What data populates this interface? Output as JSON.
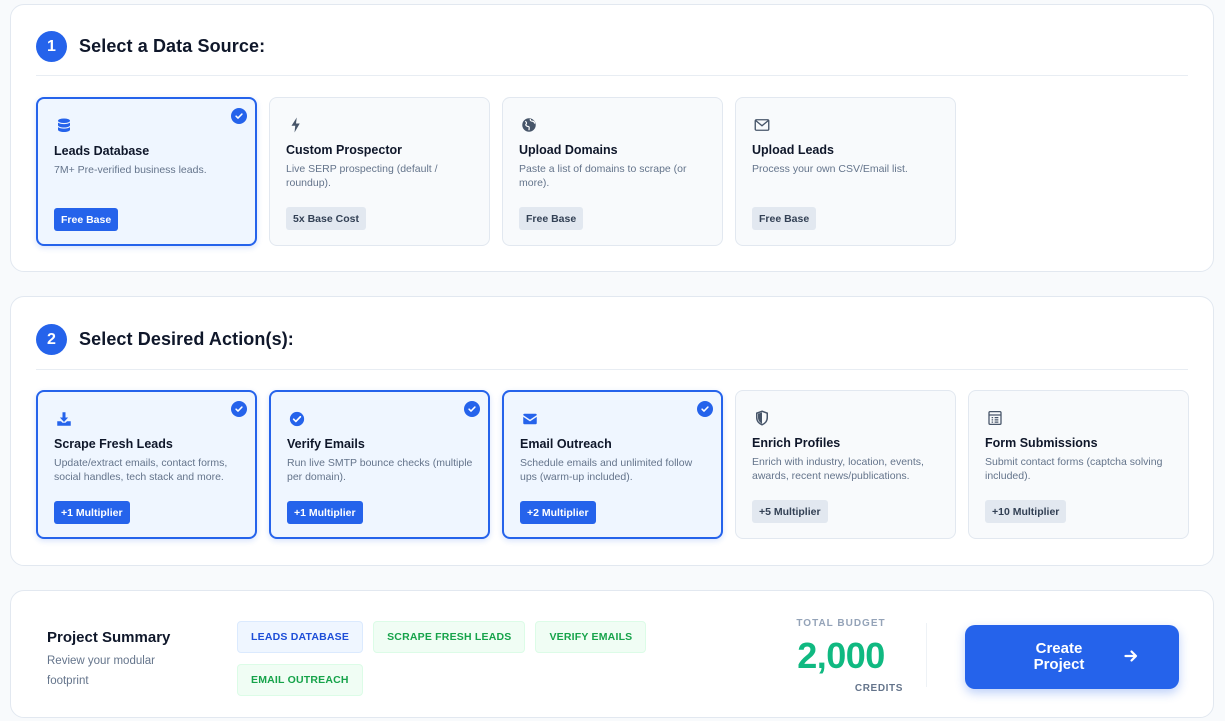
{
  "source_section": {
    "step": "1",
    "title": "Select a Data Source:",
    "cards": [
      {
        "icon": "database-icon",
        "title": "Leads Database",
        "desc": "7M+ Pre-verified business leads.",
        "badge": "Free Base",
        "selected": true
      },
      {
        "icon": "bolt-icon",
        "title": "Custom Prospector",
        "desc": "Live SERP prospecting (default / roundup).",
        "badge": "5x Base Cost",
        "selected": false
      },
      {
        "icon": "globe-icon",
        "title": "Upload Domains",
        "desc": "Paste a list of domains to scrape (or more).",
        "badge": "Free Base",
        "selected": false
      },
      {
        "icon": "envelope-outline-icon",
        "title": "Upload Leads",
        "desc": "Process your own CSV/Email list.",
        "badge": "Free Base",
        "selected": false
      }
    ]
  },
  "action_section": {
    "step": "2",
    "title": "Select Desired Action(s):",
    "cards": [
      {
        "icon": "download-icon",
        "title": "Scrape Fresh Leads",
        "desc": "Update/extract emails, contact forms, social handles, tech stack and more.",
        "badge": "+1 Multiplier",
        "selected": true
      },
      {
        "icon": "check-circle-icon",
        "title": "Verify Emails",
        "desc": "Run live SMTP bounce checks (multiple per domain).",
        "badge": "+1 Multiplier",
        "selected": true
      },
      {
        "icon": "envelope-filled-icon",
        "title": "Email Outreach",
        "desc": "Schedule emails and unlimited follow ups (warm-up included).",
        "badge": "+2 Multiplier",
        "selected": true
      },
      {
        "icon": "shield-icon",
        "title": "Enrich Profiles",
        "desc": "Enrich with industry, location, events, awards, recent news/publications.",
        "badge": "+5 Multiplier",
        "selected": false
      },
      {
        "icon": "form-icon",
        "title": "Form Submissions",
        "desc": "Submit contact forms (captcha solving included).",
        "badge": "+10 Multiplier",
        "selected": false
      }
    ]
  },
  "summary": {
    "title": "Project Summary",
    "subtitle": "Review your modular footprint",
    "tags": [
      {
        "label": "LEADS DATABASE",
        "color": "blue"
      },
      {
        "label": "SCRAPE FRESH LEADS",
        "color": "green"
      },
      {
        "label": "VERIFY EMAILS",
        "color": "green"
      },
      {
        "label": "EMAIL OUTREACH",
        "color": "green"
      }
    ],
    "budget_label": "TOTAL BUDGET",
    "budget_value": "2,000",
    "budget_unit": "CREDITS",
    "create_label": "Create Project"
  },
  "colors": {
    "accent": "#2563eb",
    "success": "#10b981",
    "muted": "#64748b"
  }
}
